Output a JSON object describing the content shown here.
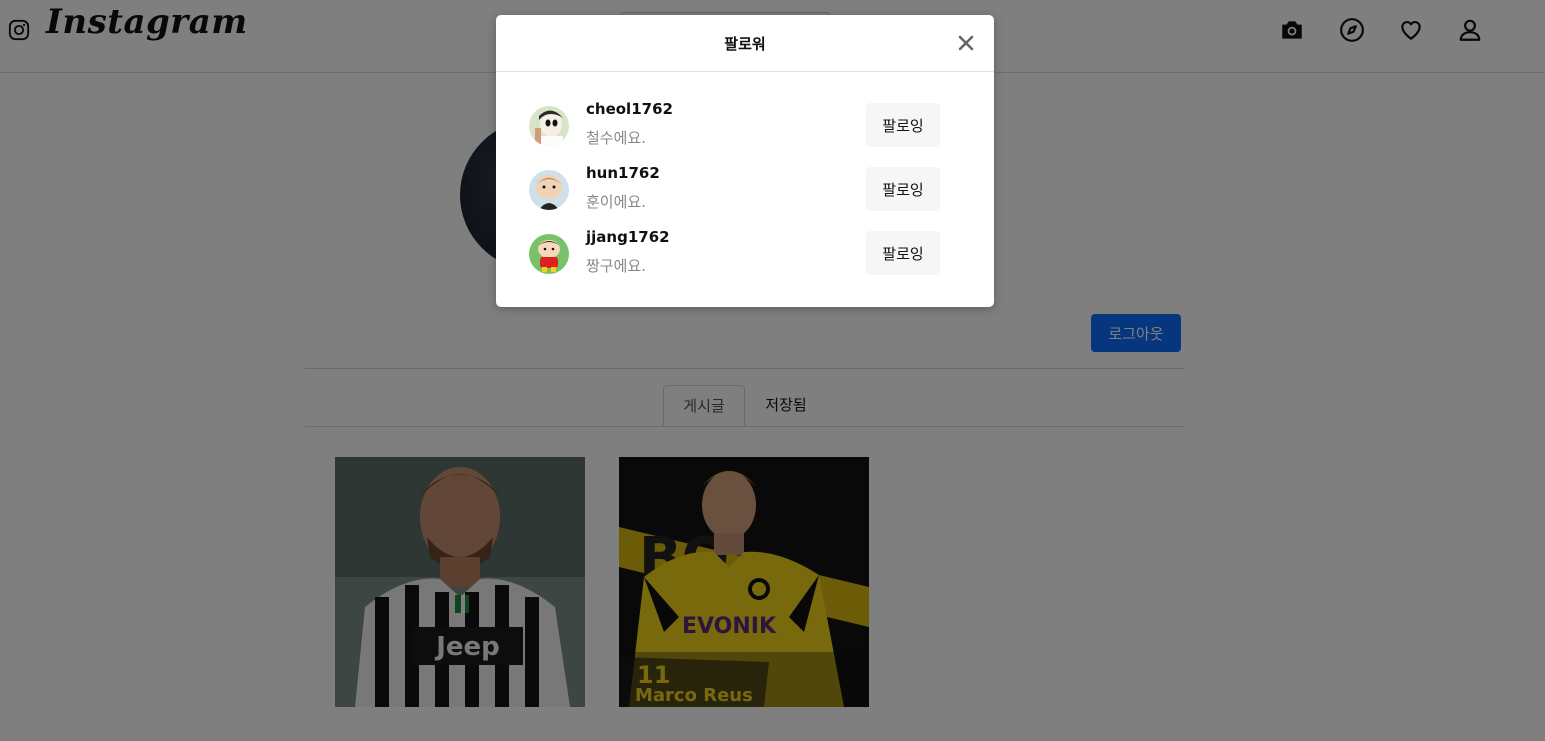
{
  "nav": {
    "brand": "Instagram",
    "icons": [
      "camera-icon",
      "compass-icon",
      "heart-icon",
      "user-icon"
    ]
  },
  "profile": {
    "logout_label": "로그아웃",
    "tabs": [
      {
        "label": "게시글",
        "active": true
      },
      {
        "label": "저장됨",
        "active": false
      }
    ],
    "posts": [
      {
        "label": "Jeep",
        "accent": "#f1f1f1"
      },
      {
        "label": "EVONIK",
        "number": "11",
        "name": "Marco Reus",
        "accent": "#f3d21a"
      }
    ]
  },
  "modal": {
    "title": "팔로워",
    "close_icon": "close-icon",
    "users": [
      {
        "username": "cheol1762",
        "bio": "철수에요.",
        "button_label": "팔로잉"
      },
      {
        "username": "hun1762",
        "bio": "훈이에요.",
        "button_label": "팔로잉"
      },
      {
        "username": "jjang1762",
        "bio": "짱구에요.",
        "button_label": "팔로잉"
      }
    ]
  },
  "colors": {
    "primary_button": "#0d6efd",
    "backdrop": "rgba(0,0,0,0.5)"
  }
}
